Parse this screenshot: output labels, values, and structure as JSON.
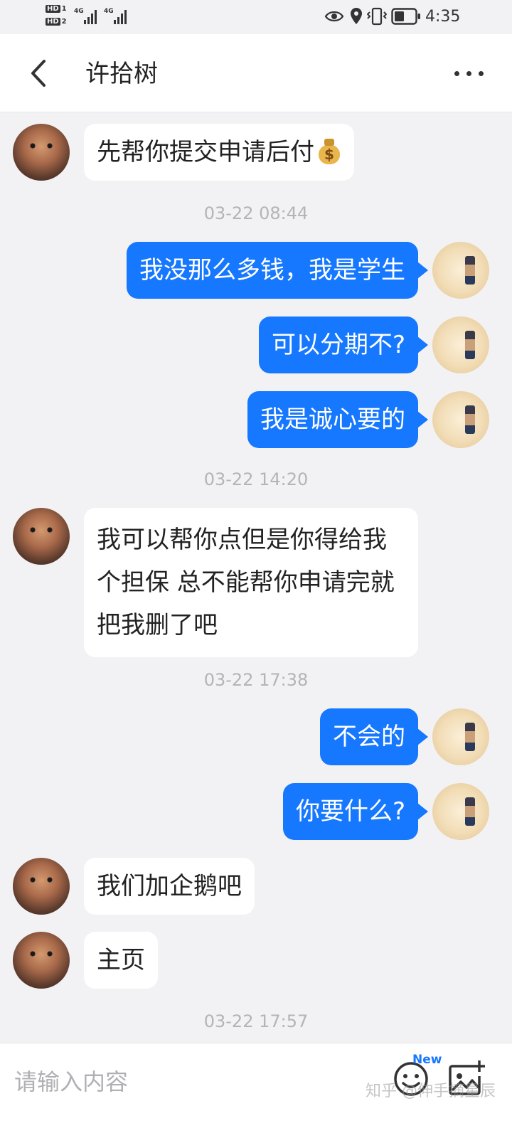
{
  "status_bar": {
    "sim1_label": "HD",
    "sim1_index": "1",
    "sim2_label": "HD",
    "sim2_index": "2",
    "network1": "4G",
    "network2": "4G",
    "time": "4:35"
  },
  "header": {
    "title": "许拾树"
  },
  "messages": [
    {
      "side": "in",
      "text": "先帮你提交申请后付"
    },
    {
      "side": "time",
      "text": "03-22 08:44"
    },
    {
      "side": "out",
      "text": "我没那么多钱，我是学生"
    },
    {
      "side": "out",
      "text": "可以分期不?"
    },
    {
      "side": "out",
      "text": "我是诚心要的"
    },
    {
      "side": "time",
      "text": "03-22 14:20"
    },
    {
      "side": "in",
      "text": "我可以帮你点但是你得给我个担保 总不能帮你申请完就把我删了吧"
    },
    {
      "side": "time",
      "text": "03-22 17:38"
    },
    {
      "side": "out",
      "text": "不会的"
    },
    {
      "side": "out",
      "text": "你要什么?"
    },
    {
      "side": "in",
      "text": "我们加企鹅吧"
    },
    {
      "side": "in",
      "text": "主页"
    },
    {
      "side": "time",
      "text": "03-22 17:57"
    }
  ],
  "input_bar": {
    "placeholder": "请输入内容",
    "new_badge": "New",
    "emoji_icon": "emoji-icon",
    "image_icon": "add-image-icon"
  },
  "watermark": "知乎 @伸手摘星辰",
  "colors": {
    "accent": "#1677ff",
    "background": "#f2f2f4",
    "bubble_in": "#ffffff",
    "timestamp": "#b4b4b8"
  }
}
